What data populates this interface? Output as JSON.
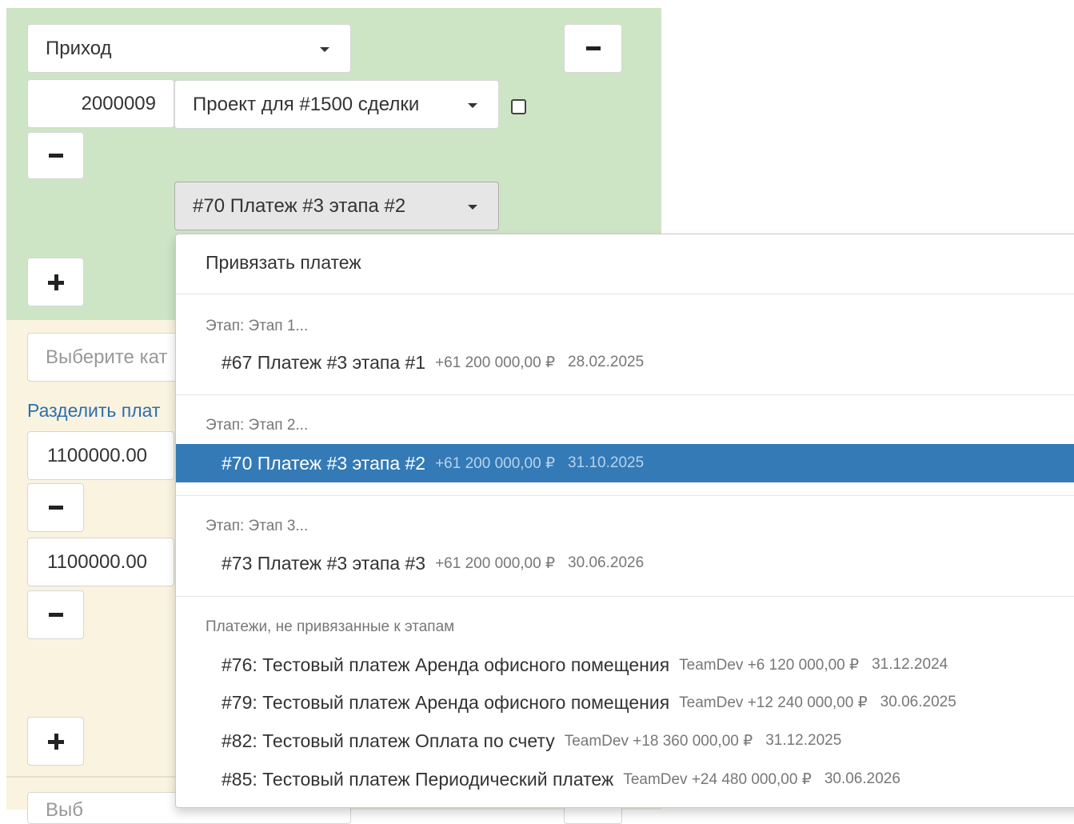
{
  "form": {
    "type_select": "Приход",
    "amount_value": "2000009",
    "project_select": "Проект для #1500 сделки",
    "payment_select": "#70 Платеж #3 этапа #2",
    "category_placeholder": "Выберите кат",
    "split_link": "Разделить плат",
    "split_amount_1": "1100000.00",
    "split_amount_2": "1100000.00",
    "bottom_placeholder": "Выб"
  },
  "menu": {
    "header": "Привязать платеж",
    "groups": [
      {
        "label": "Этап: Этап 1...",
        "items": [
          {
            "name": "#67 Платеж #3 этапа #1",
            "amount": "+61 200 000,00 ₽",
            "date": "28.02.2025"
          }
        ]
      },
      {
        "label": "Этап: Этап 2...",
        "items": [
          {
            "name": "#70 Платеж #3 этапа #2",
            "amount": "+61 200 000,00 ₽",
            "date": "31.10.2025"
          }
        ]
      },
      {
        "label": "Этап: Этап 3...",
        "items": [
          {
            "name": "#73 Платеж #3 этапа #3",
            "amount": "+61 200 000,00 ₽",
            "date": "30.06.2026"
          }
        ]
      },
      {
        "label": "Платежи, не привязанные к этапам",
        "items": [
          {
            "name": "#76: Тестовый платеж Аренда офисного помещения",
            "amount": "TeamDev +6 120 000,00 ₽",
            "date": "31.12.2024"
          },
          {
            "name": "#79: Тестовый платеж Аренда офисного помещения",
            "amount": "TeamDev +12 240 000,00 ₽",
            "date": "30.06.2025"
          },
          {
            "name": "#82: Тестовый платеж Оплата по счету",
            "amount": "TeamDev +18 360 000,00 ₽",
            "date": "31.12.2025"
          },
          {
            "name": "#85: Тестовый платеж Периодический платеж",
            "amount": "TeamDev +24 480 000,00 ₽",
            "date": "30.06.2026"
          }
        ]
      }
    ]
  },
  "colors": {
    "green_panel": "#cde5c5",
    "cream_panel": "#f9f3e0",
    "active_item": "#337ab7",
    "link": "#2a6fb0"
  }
}
